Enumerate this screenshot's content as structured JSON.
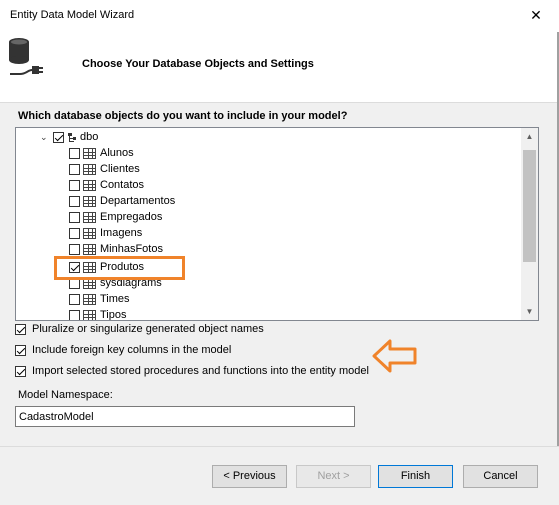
{
  "window": {
    "title": "Entity Data Model Wizard",
    "close_glyph": "✕"
  },
  "header": {
    "title": "Choose Your Database Objects and Settings",
    "icon": "database-connect-icon"
  },
  "question": "Which database objects do you want to include in your model?",
  "tree": {
    "schema": {
      "label": "dbo",
      "checked": true,
      "expanded": true
    },
    "tables": [
      {
        "label": "Alunos",
        "checked": false
      },
      {
        "label": "Clientes",
        "checked": false
      },
      {
        "label": "Contatos",
        "checked": false
      },
      {
        "label": "Departamentos",
        "checked": false
      },
      {
        "label": "Empregados",
        "checked": false
      },
      {
        "label": "Imagens",
        "checked": false
      },
      {
        "label": "MinhasFotos",
        "checked": false
      },
      {
        "label": "Produtos",
        "checked": true
      },
      {
        "label": "sysdiagrams",
        "checked": false
      },
      {
        "label": "Times",
        "checked": false
      },
      {
        "label": "Tipos",
        "checked": false
      }
    ]
  },
  "options": [
    {
      "label": "Pluralize or singularize generated object names",
      "checked": true
    },
    {
      "label": "Include foreign key columns in the model",
      "checked": true
    },
    {
      "label": "Import selected stored procedures and functions into the entity model",
      "checked": true
    }
  ],
  "namespace": {
    "label": "Model Namespace:",
    "value": "CadastroModel"
  },
  "buttons": {
    "previous": "< Previous",
    "next": "Next >",
    "finish": "Finish",
    "cancel": "Cancel"
  },
  "colors": {
    "highlight": "#f0832a",
    "accent": "#0078d7"
  }
}
